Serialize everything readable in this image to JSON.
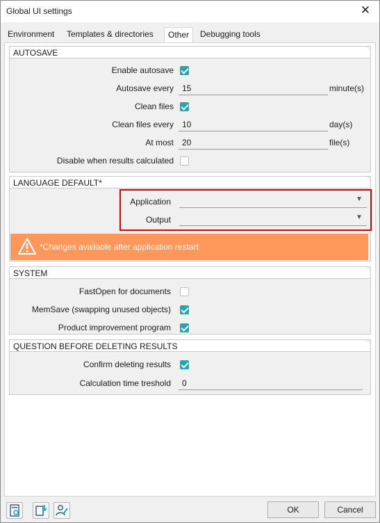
{
  "window": {
    "title": "Global UI settings"
  },
  "tabs": [
    {
      "label": "Environment"
    },
    {
      "label": "Templates & directories"
    },
    {
      "label": "Other",
      "active": true
    },
    {
      "label": "Debugging tools"
    }
  ],
  "autosave": {
    "title": "AUTOSAVE",
    "enable_autosave": {
      "label": "Enable autosave",
      "checked": true
    },
    "autosave_every": {
      "label": "Autosave every",
      "value": "15",
      "unit": "minute(s)"
    },
    "clean_files": {
      "label": "Clean files",
      "checked": true
    },
    "clean_files_every": {
      "label": "Clean files every",
      "value": "10",
      "unit": "day(s)"
    },
    "at_most": {
      "label": "At most",
      "value": "20",
      "unit": "file(s)"
    },
    "disable_when_results": {
      "label": "Disable when results calculated",
      "checked": false
    }
  },
  "language": {
    "title": "LANGUAGE DEFAULT*",
    "application": {
      "label": "Application",
      "value": ""
    },
    "output": {
      "label": "Output",
      "value": ""
    },
    "warning": "*Changes available after application restart"
  },
  "system": {
    "title": "SYSTEM",
    "fastopen": {
      "label": "FastOpen for documents",
      "checked": false
    },
    "memsave": {
      "label": "MemSave (swapping unused objects)",
      "checked": true
    },
    "product_improvement": {
      "label": "Product improvement program",
      "checked": true
    }
  },
  "question": {
    "title": "QUESTION BEFORE DELETING RESULTS",
    "confirm_deleting": {
      "label": "Confirm deleting results",
      "checked": true
    },
    "calc_time_threshold": {
      "label": "Calculation time treshold",
      "value": "0"
    }
  },
  "buttons": {
    "ok": "OK",
    "cancel": "Cancel"
  },
  "colors": {
    "accent": "#1ba9b5",
    "warning_bg": "#fe975a",
    "highlight": "#e00000"
  },
  "icons": [
    "close-icon",
    "checkmark-icon",
    "chevron-down-icon",
    "warning-icon",
    "document-settings-icon",
    "import-settings-icon",
    "user-settings-icon"
  ]
}
